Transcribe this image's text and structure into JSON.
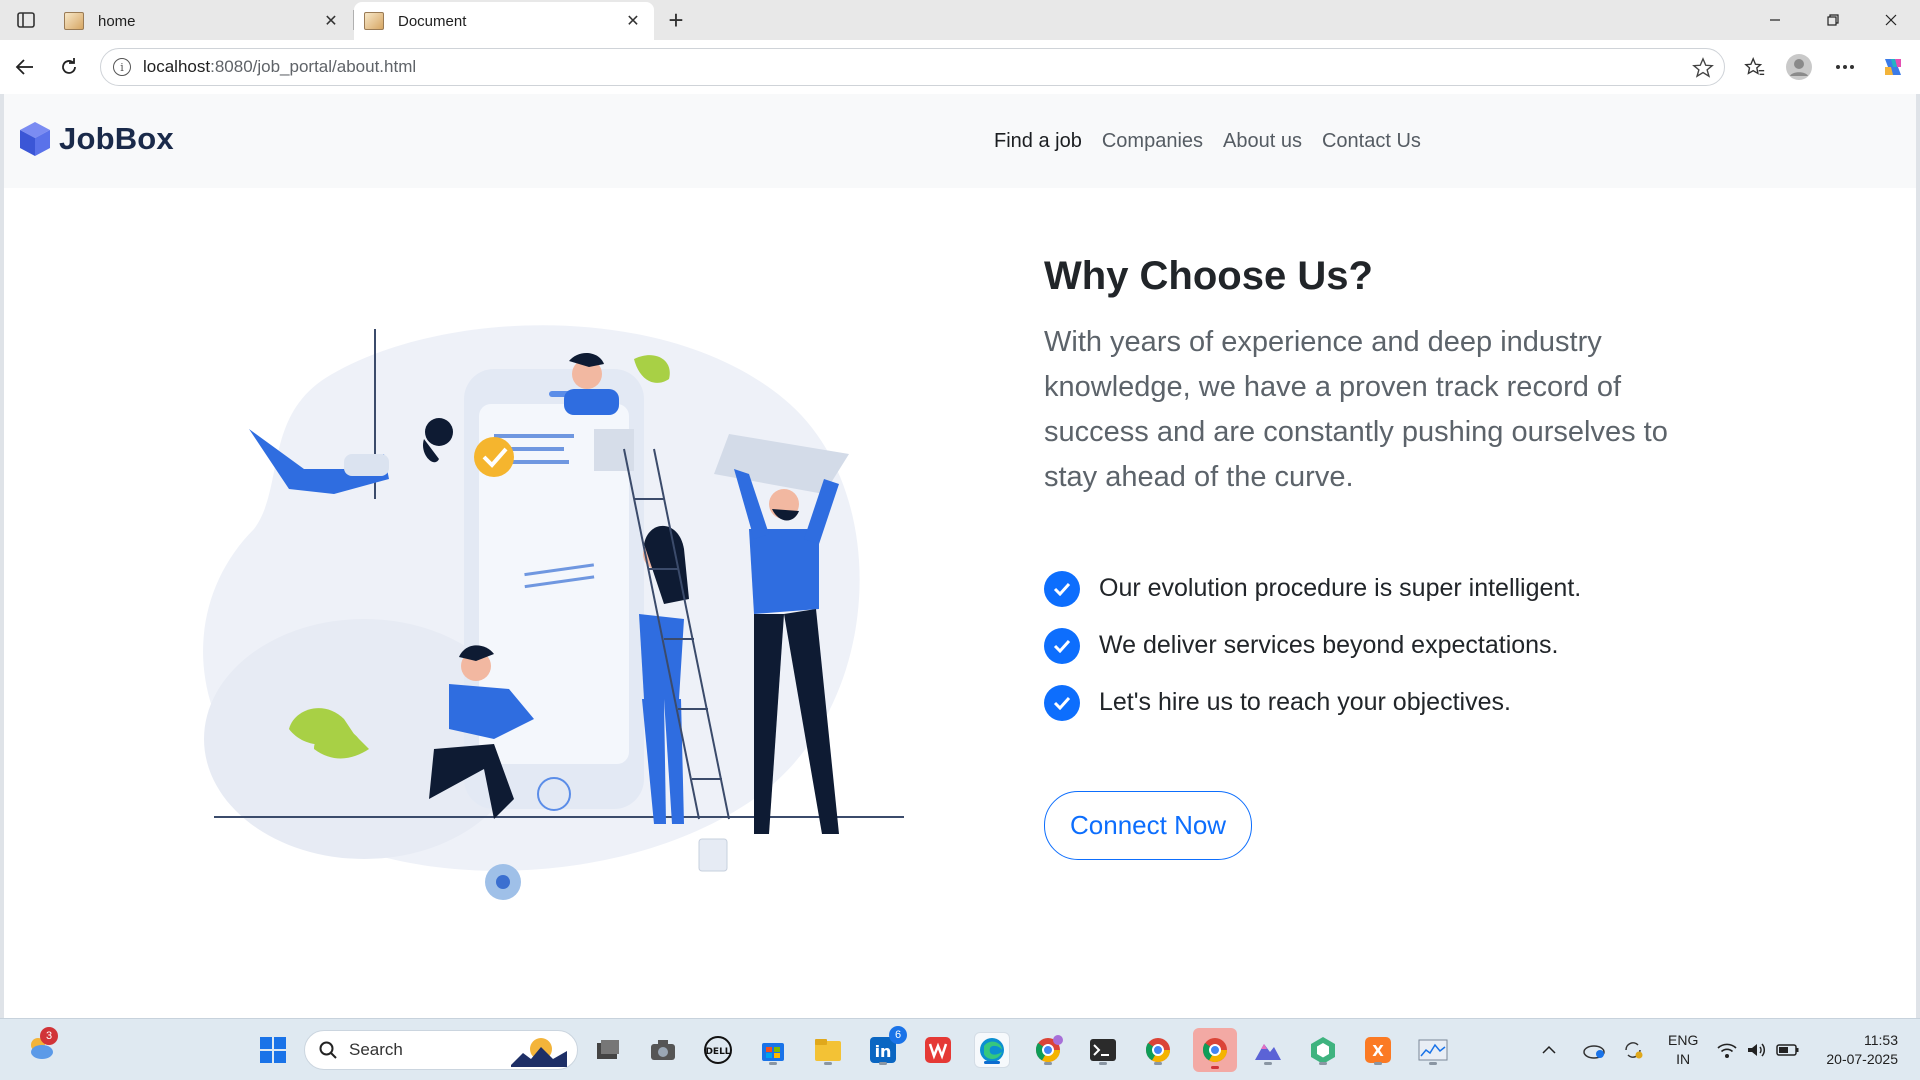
{
  "browser": {
    "tabs": [
      {
        "title": "home",
        "active": false
      },
      {
        "title": "Document",
        "active": true
      }
    ],
    "url": {
      "host": "localhost",
      "path": ":8080/job_portal/about.html"
    }
  },
  "site": {
    "brand": "JobBox",
    "nav": [
      {
        "label": "Find a job",
        "active": true
      },
      {
        "label": "Companies",
        "active": false
      },
      {
        "label": "About us",
        "active": false
      },
      {
        "label": "Contact Us",
        "active": false
      }
    ]
  },
  "about": {
    "heading": "Why Choose Us?",
    "lead": "With years of experience and deep industry knowledge, we have a proven track record of success and are constantly pushing ourselves to stay ahead of the curve.",
    "features": [
      "Our evolution procedure is super intelligent.",
      "We deliver services beyond expectations.",
      "Let's hire us to reach your objectives."
    ],
    "cta": "Connect Now"
  },
  "taskbar": {
    "search_placeholder": "Search",
    "widgets_badge": "3",
    "linkedin_badge": "6",
    "language": [
      "ENG",
      "IN"
    ],
    "time": "11:53",
    "date": "20-07-2025"
  },
  "colors": {
    "accent": "#0d6efd",
    "brand_dark": "#1a2a4a",
    "header_bg": "#f8f9fa"
  }
}
